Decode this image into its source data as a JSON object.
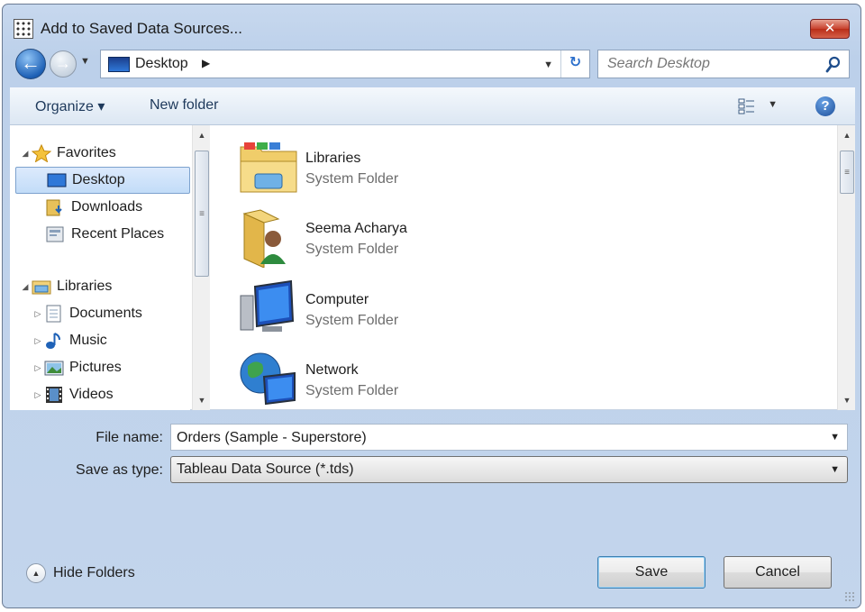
{
  "window": {
    "title": "Add to Saved Data Sources...",
    "close_label": "✕"
  },
  "nav": {
    "back_icon": "arrow-left-icon",
    "forward_icon": "arrow-right-icon",
    "location": "Desktop",
    "location_arrow": "▶",
    "refresh_glyph": "↻",
    "search_placeholder": "Search Desktop"
  },
  "toolbar": {
    "organize_label": "Organize ▾",
    "new_folder_label": "New folder",
    "view_drop": "▼",
    "help_glyph": "?"
  },
  "sidebar": {
    "favorites": {
      "label": "Favorites",
      "items": [
        {
          "label": "Desktop"
        },
        {
          "label": "Downloads"
        },
        {
          "label": "Recent Places"
        }
      ]
    },
    "libraries": {
      "label": "Libraries",
      "items": [
        {
          "label": "Documents"
        },
        {
          "label": "Music"
        },
        {
          "label": "Pictures"
        },
        {
          "label": "Videos"
        }
      ]
    }
  },
  "files": [
    {
      "name": "Libraries",
      "type": "System Folder"
    },
    {
      "name": "Seema Acharya",
      "type": "System Folder"
    },
    {
      "name": "Computer",
      "type": "System Folder"
    },
    {
      "name": "Network",
      "type": "System Folder"
    }
  ],
  "form": {
    "file_name_label": "File name:",
    "file_name_value": "Orders (Sample - Superstore)",
    "save_type_label": "Save as type:",
    "save_type_value": "Tableau Data Source (*.tds)"
  },
  "footer": {
    "hide_folders_label": "Hide Folders",
    "save_label": "Save",
    "cancel_label": "Cancel"
  },
  "colors": {
    "chrome": "#bcd0ea",
    "accent": "#1f62b7",
    "close": "#c8412d"
  }
}
